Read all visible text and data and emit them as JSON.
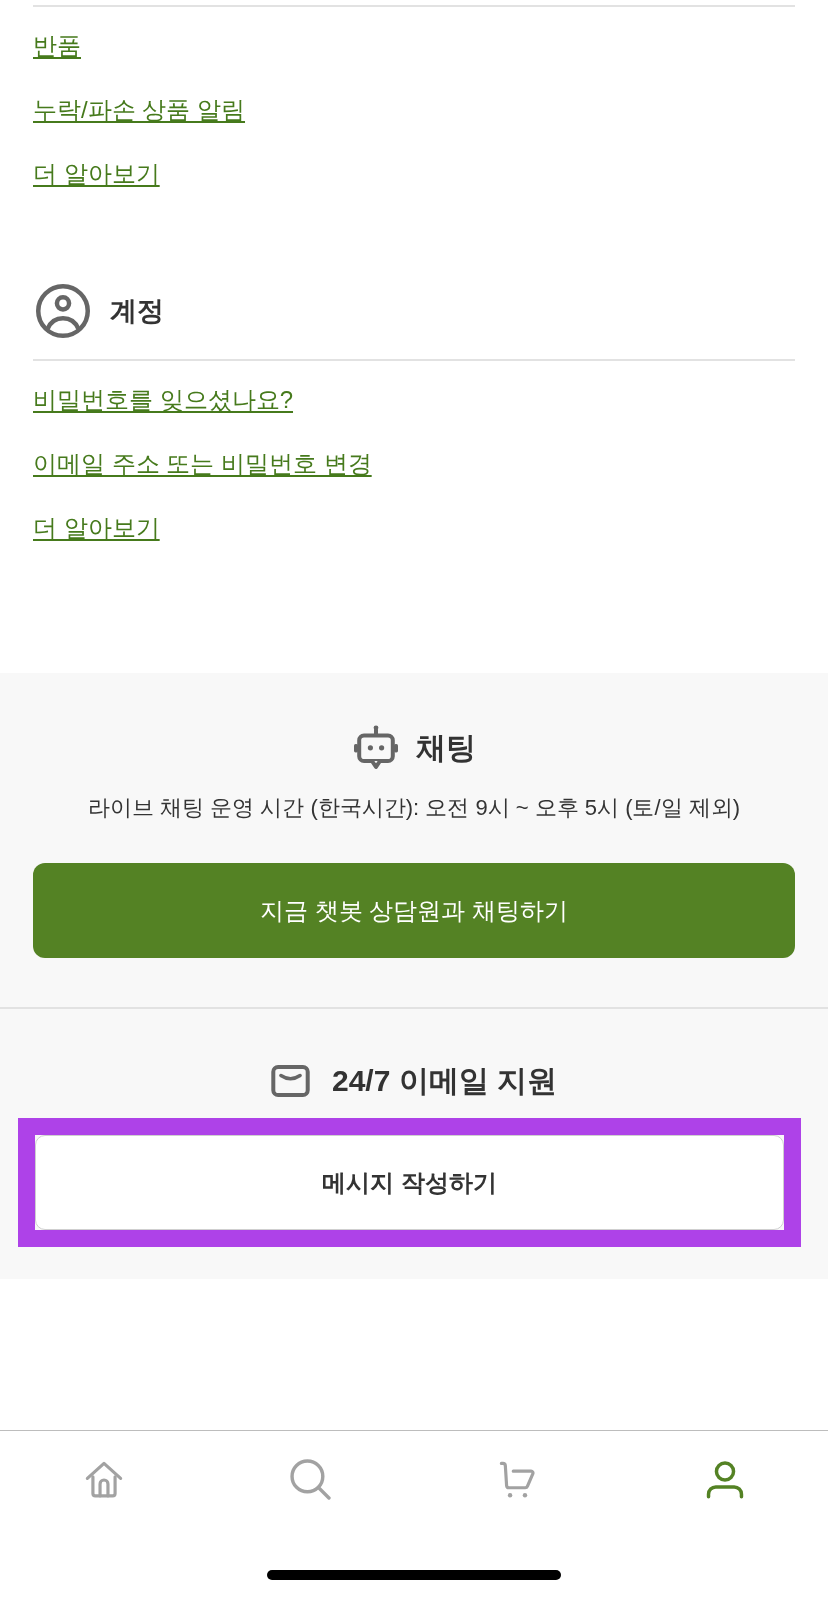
{
  "help_sections": [
    {
      "links": [
        "반품",
        "누락/파손 상품 알림",
        "더 알아보기"
      ]
    },
    {
      "kind": "account",
      "title": "계정",
      "links": [
        "비밀번호를 잊으셨나요?",
        "이메일 주소 또는 비밀번호 변경",
        "더 알아보기"
      ]
    }
  ],
  "contact": [
    {
      "kind": "chat",
      "title": "채팅",
      "hours": "라이브 채팅 운영 시간 (한국시간): 오전 9시 ~ 오후 5시 (토/일 제외)",
      "button": {
        "label": "지금 챗봇 상담원과 채팅하기",
        "kind": "primary",
        "highlighted": false
      }
    },
    {
      "kind": "email",
      "title": "24/7 이메일 지원",
      "button": {
        "label": "메시지 작성하기",
        "kind": "secondary",
        "highlighted": true
      }
    }
  ],
  "bottom_nav": [
    {
      "kind": "home",
      "selected": false
    },
    {
      "kind": "search",
      "selected": false
    },
    {
      "kind": "cart",
      "selected": false
    },
    {
      "kind": "account",
      "selected": true
    }
  ]
}
